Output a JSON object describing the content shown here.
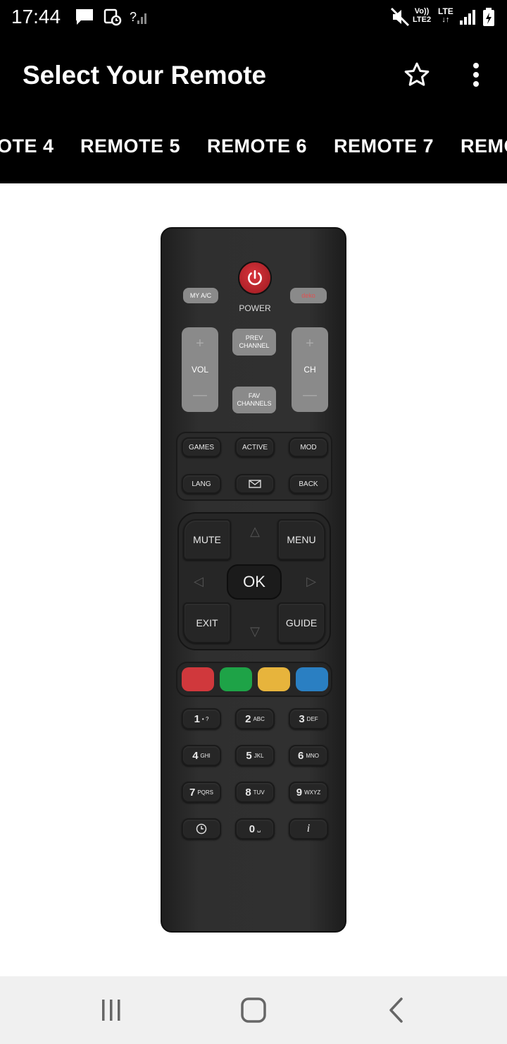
{
  "status": {
    "time": "17:44",
    "network_label_1": "Vo))",
    "network_label_2": "LTE2",
    "lte": "LTE",
    "unknown_signal": "?"
  },
  "appbar": {
    "title": "Select Your Remote"
  },
  "tabs": [
    "OTE 4",
    "REMOTE 5",
    "REMOTE 6",
    "REMOTE 7",
    "REMO"
  ],
  "remote": {
    "power_label": "POWER",
    "my_ac": "MY A/C",
    "top_right": "deko",
    "vol": "VOL",
    "ch": "CH",
    "prev_channel": "PREV CHANNEL",
    "fav_channels": "FAV CHANNELS",
    "games": "GAMES",
    "active": "ACTIVE",
    "mod": "MOD",
    "lang": "LANG",
    "back": "BACK",
    "mute": "MUTE",
    "menu": "MENU",
    "ok": "OK",
    "exit": "EXIT",
    "guide": "GUIDE",
    "colors": [
      "#d0383c",
      "#1ea347",
      "#e7b43c",
      "#2a7fc2"
    ],
    "keys": [
      {
        "num": "1",
        "sub": "• ?"
      },
      {
        "num": "2",
        "sub": "ABC"
      },
      {
        "num": "3",
        "sub": "DEF"
      },
      {
        "num": "4",
        "sub": "GHI"
      },
      {
        "num": "5",
        "sub": "JKL"
      },
      {
        "num": "6",
        "sub": "MNO"
      },
      {
        "num": "7",
        "sub": "PQRS"
      },
      {
        "num": "8",
        "sub": "TUV"
      },
      {
        "num": "9",
        "sub": "WXYZ"
      },
      {
        "num": "0",
        "sub": "␣"
      }
    ],
    "info": "i"
  }
}
